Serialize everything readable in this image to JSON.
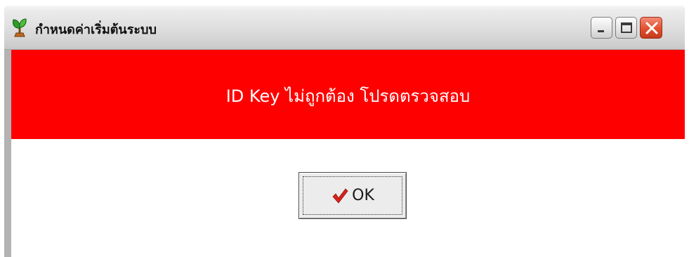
{
  "window": {
    "title": "กำหนดค่าเริ่มต้นระบบ",
    "app_icon": "sprout-icon",
    "controls": {
      "minimize_icon": "minimize-icon",
      "maximize_icon": "maximize-icon",
      "close_icon": "close-icon"
    }
  },
  "message": {
    "text": "ID Key ไม่ถูกต้อง  โปรดตรวจสอบ",
    "background_color": "#ff0000",
    "text_color": "#ffffff"
  },
  "ok_button": {
    "label": "OK",
    "icon": "checkmark-icon",
    "icon_color": "#d8231a"
  }
}
